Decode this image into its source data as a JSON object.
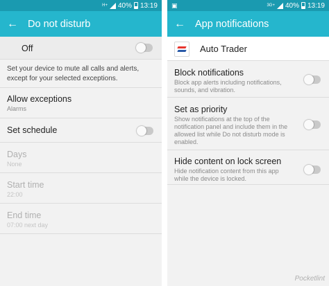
{
  "left": {
    "status": {
      "left_icon": "",
      "network": "H+",
      "battery": "40%",
      "time": "13:19"
    },
    "appbar": {
      "title": "Do not disturb"
    },
    "master": {
      "label": "Off"
    },
    "description": "Set your device to mute all calls and alerts, except for your selected exceptions.",
    "exceptions": {
      "title": "Allow exceptions",
      "value": "Alarms"
    },
    "schedule": {
      "title": "Set schedule"
    },
    "days": {
      "title": "Days",
      "value": "None"
    },
    "start": {
      "title": "Start time",
      "value": "22:00"
    },
    "end": {
      "title": "End time",
      "value": "07:00 next day"
    }
  },
  "right": {
    "status": {
      "left_icon": "image-icon",
      "network": "3G+",
      "battery": "40%",
      "time": "13:19"
    },
    "appbar": {
      "title": "App notifications"
    },
    "app": {
      "name": "Auto Trader"
    },
    "block": {
      "title": "Block notifications",
      "desc": "Block app alerts including notifications, sounds, and vibration."
    },
    "priority": {
      "title": "Set as priority",
      "desc": "Show notifications at the top of the notification panel and include them in the allowed list while Do not disturb mode is enabled."
    },
    "hide": {
      "title": "Hide content on lock screen",
      "desc": "Hide notification content from this app while the device is locked."
    }
  },
  "watermark": "Pocketlint",
  "colors": {
    "statusbar": "#1a9ab0",
    "appbar": "#25b6cd",
    "background": "#f2f2f2",
    "toggle_off": "#c9c9c9"
  }
}
